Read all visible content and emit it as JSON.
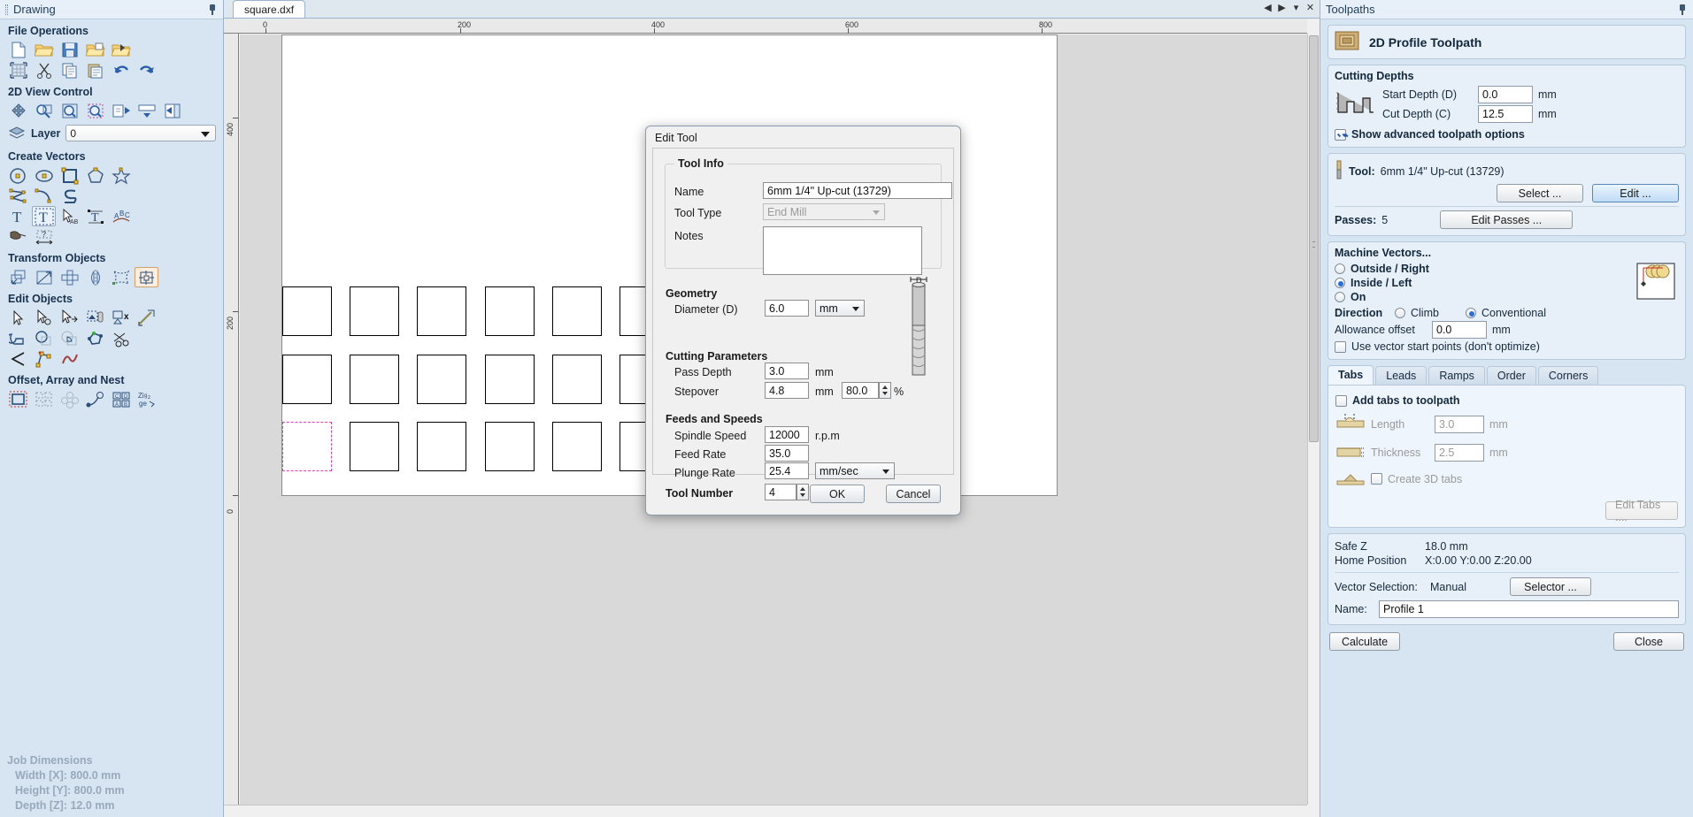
{
  "left_panel": {
    "title": "Drawing",
    "sections": [
      {
        "name": "File Operations",
        "title": "File Operations"
      },
      {
        "name": "2D View Control",
        "title": "2D View Control"
      },
      {
        "name": "Create Vectors",
        "title": "Create Vectors"
      },
      {
        "name": "Transform Objects",
        "title": "Transform Objects"
      },
      {
        "name": "Edit Objects",
        "title": "Edit Objects"
      },
      {
        "name": "Offset, Array and Nest",
        "title": "Offset, Array and Nest"
      }
    ],
    "layer": {
      "label": "Layer",
      "value": "0"
    },
    "job_dimensions": {
      "title": "Job Dimensions",
      "width": "Width  [X]: 800.0 mm",
      "height": "Height [Y]: 800.0 mm",
      "depth": "Depth  [Z]: 12.0 mm"
    }
  },
  "center": {
    "tab_label": "square.dxf",
    "ruler_top_ticks": [
      "0",
      "200",
      "400",
      "600",
      "800"
    ],
    "ruler_left_ticks": [
      "400",
      "200",
      "0"
    ]
  },
  "right_panel": {
    "title": "Toolpaths",
    "toolpath_type": "2D Profile Toolpath",
    "cutting_depths": {
      "title": "Cutting Depths",
      "start_depth_label": "Start Depth (D)",
      "start_depth_value": "0.0",
      "start_depth_unit": "mm",
      "cut_depth_label": "Cut Depth (C)",
      "cut_depth_value": "12.5",
      "cut_depth_unit": "mm",
      "advanced_label": "Show advanced toolpath options",
      "advanced_checked": true
    },
    "tool": {
      "label": "Tool:",
      "name": "6mm 1/4\" Up-cut (13729)",
      "select_button": "Select ...",
      "edit_button": "Edit ...",
      "passes_label": "Passes:",
      "passes_value": "5",
      "edit_passes_button": "Edit Passes ..."
    },
    "machine_vectors": {
      "title": "Machine Vectors...",
      "options": [
        {
          "label": "Outside / Right",
          "selected": false
        },
        {
          "label": "Inside / Left",
          "selected": true
        },
        {
          "label": "On",
          "selected": false
        }
      ],
      "direction_label": "Direction",
      "direction_options": [
        {
          "label": "Climb",
          "selected": false
        },
        {
          "label": "Conventional",
          "selected": true
        }
      ],
      "allowance_label": "Allowance offset",
      "allowance_value": "0.0",
      "allowance_unit": "mm",
      "start_points_label": "Use vector start points (don't optimize)",
      "start_points_checked": false
    },
    "tabs": {
      "items": [
        "Tabs",
        "Leads",
        "Ramps",
        "Order",
        "Corners"
      ],
      "active": "Tabs",
      "add_tabs_label": "Add tabs to toolpath",
      "add_tabs_checked": false,
      "length_label": "Length",
      "length_value": "3.0",
      "length_unit": "mm",
      "thickness_label": "Thickness",
      "thickness_value": "2.5",
      "thickness_unit": "mm",
      "create3d_label": "Create 3D tabs",
      "create3d_checked": false,
      "edit_tabs_button": "Edit Tabs ...."
    },
    "position": {
      "safe_z_label": "Safe Z",
      "safe_z_value": "18.0 mm",
      "home_label": "Home Position",
      "home_value": "X:0.00 Y:0.00 Z:20.00"
    },
    "vector_selection": {
      "label": "Vector Selection:",
      "value": "Manual",
      "selector_button": "Selector ..."
    },
    "name_field": {
      "label": "Name:",
      "value": "Profile 1"
    },
    "calculate_button": "Calculate",
    "close_button": "Close"
  },
  "dialog": {
    "title": "Edit Tool",
    "tool_info": {
      "title": "Tool Info",
      "name_label": "Name",
      "name_value": "6mm 1/4\" Up-cut (13729)",
      "tool_type_label": "Tool Type",
      "tool_type_value": "End Mill",
      "notes_label": "Notes",
      "notes_value": ""
    },
    "geometry": {
      "title": "Geometry",
      "diameter_label": "Diameter (D)",
      "diameter_value": "6.0",
      "diameter_unit": "mm"
    },
    "cutting_parameters": {
      "title": "Cutting Parameters",
      "pass_depth_label": "Pass Depth",
      "pass_depth_value": "3.0",
      "pass_depth_unit": "mm",
      "stepover_label": "Stepover",
      "stepover_value": "4.8",
      "stepover_unit": "mm",
      "stepover_pct_value": "80.0",
      "stepover_pct_unit": "%"
    },
    "feeds_and_speeds": {
      "title": "Feeds and Speeds",
      "spindle_label": "Spindle Speed",
      "spindle_value": "12000",
      "spindle_unit": "r.p.m",
      "feed_label": "Feed Rate",
      "feed_value": "35.0",
      "feed_unit": "mm/sec",
      "plunge_label": "Plunge Rate",
      "plunge_value": "25.4"
    },
    "tool_number": {
      "label": "Tool Number",
      "value": "4"
    },
    "ok_button": "OK",
    "cancel_button": "Cancel",
    "bit_top_label": "D"
  }
}
